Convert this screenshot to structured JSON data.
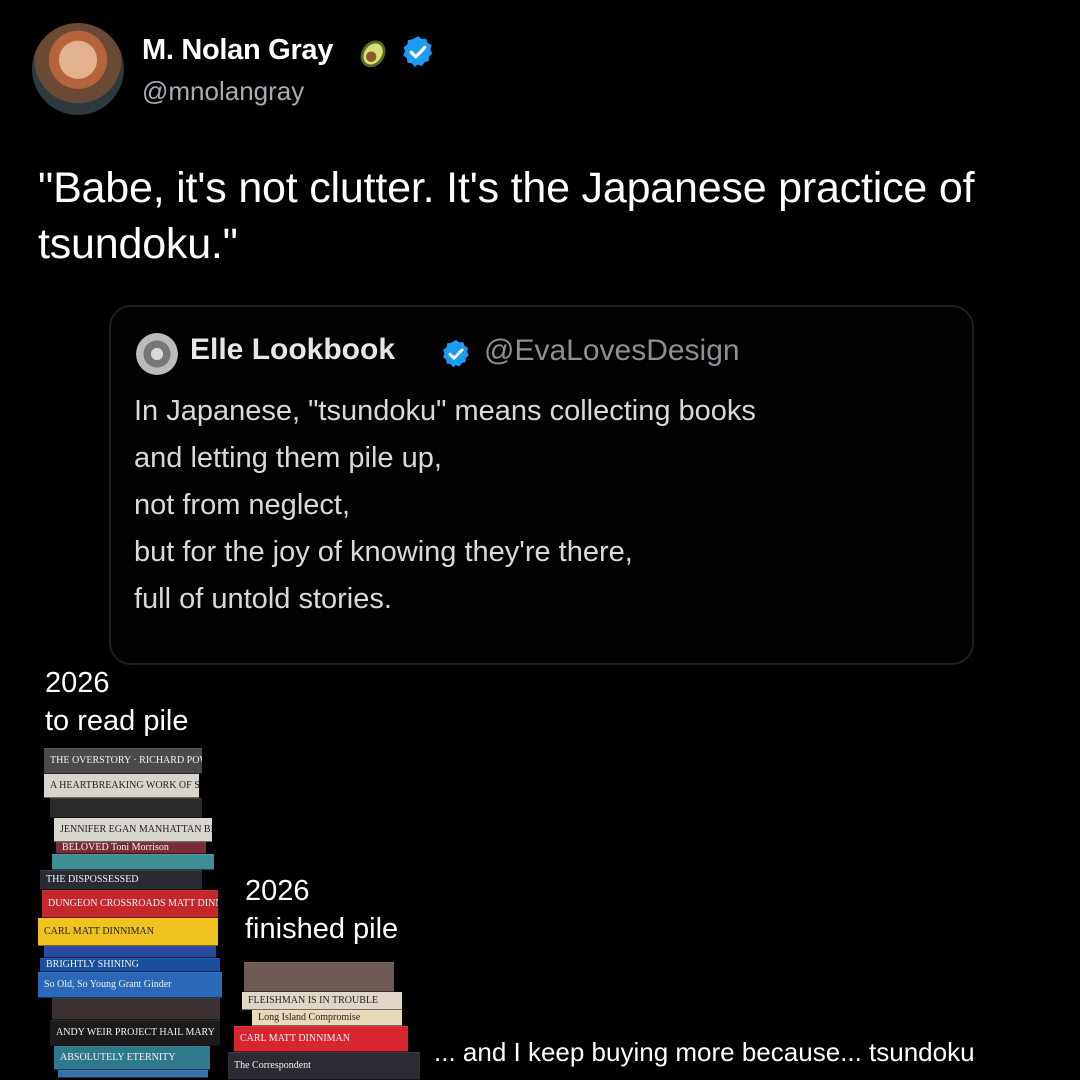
{
  "author": {
    "name": "M. Nolan Gray",
    "handle": "@mnolangray"
  },
  "tweet": {
    "text": "\"Babe, it's not clutter. It's the Japanese practice of tsundoku.\""
  },
  "quoted_tweet": {
    "name": "Elle Lookbook",
    "handle": "@EvaLovesDesign",
    "lines": [
      "In Japanese, \"tsundoku\" means collecting books",
      "and letting them pile up,",
      "not from neglect,",
      "but for the joy of knowing they're there,",
      "full of untold stories."
    ]
  },
  "meme": {
    "to_read_label": [
      "2026",
      "to read pile"
    ],
    "finished_label": [
      "2026",
      "finished pile"
    ],
    "caption": "... and I keep buying more because... tsundoku",
    "to_read_books": [
      {
        "title": "THE OVERSTORY · RICHARD POWERS",
        "color": "#4a4a4d"
      },
      {
        "title": "A HEARTBREAKING WORK OF STAGGERING GENIUS",
        "color": "#d8d4cc"
      },
      {
        "title": "",
        "color": "#2d2a2a"
      },
      {
        "title": "JENNIFER EGAN   MANHATTAN BEACH",
        "color": "#d9d6cf"
      },
      {
        "title": "BELOVED   Toni Morrison",
        "color": "#7a2b3a"
      },
      {
        "title": "",
        "color": "#3f8f94"
      },
      {
        "title": "THE DISPOSSESSED",
        "color": "#2a2a33"
      },
      {
        "title": "DUNGEON CROSSROADS   MATT DINNIMAN",
        "color": "#c4282b"
      },
      {
        "title": "CARL   MATT DINNIMAN",
        "color": "#f0c21d"
      },
      {
        "title": "",
        "color": "#2a4aa0"
      },
      {
        "title": "BRIGHTLY SHINING",
        "color": "#1a4f9e"
      },
      {
        "title": "So Old, So Young   Grant Ginder",
        "color": "#2a68b8"
      },
      {
        "title": "",
        "color": "#3b3030"
      },
      {
        "title": "ANDY WEIR   PROJECT HAIL MARY",
        "color": "#1b1b1d"
      },
      {
        "title": "ABSOLUTELY ETERNITY",
        "color": "#2e7a8c"
      },
      {
        "title": "",
        "color": "#3c6ea8"
      }
    ],
    "finished_books": [
      {
        "title": "",
        "color": "#6e5a55"
      },
      {
        "title": "FLEISHMAN IS IN TROUBLE",
        "color": "#e0d6c8"
      },
      {
        "title": "Long Island Compromise",
        "color": "#e9d9b9"
      },
      {
        "title": "CARL   MATT DINNIMAN",
        "color": "#d7262f"
      },
      {
        "title": "The Correspondent",
        "color": "#2b2b33"
      }
    ]
  }
}
